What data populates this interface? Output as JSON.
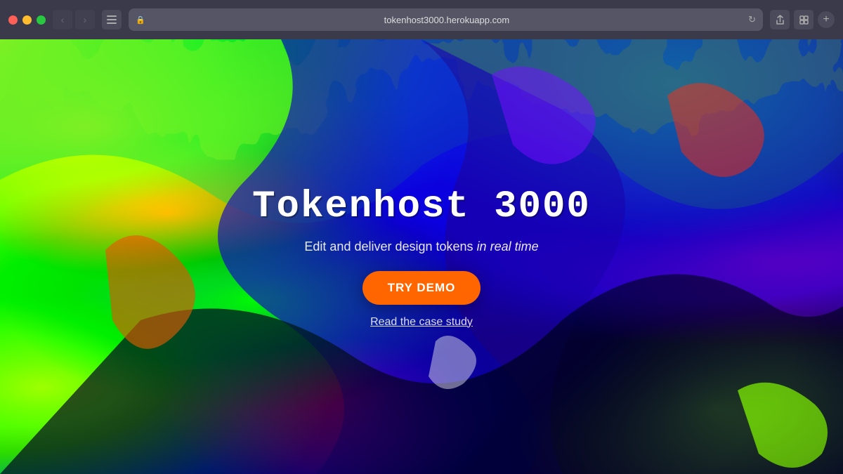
{
  "browser": {
    "url": "tokenhost3000.herokuapp.com",
    "traffic_lights": [
      "close",
      "minimize",
      "maximize"
    ],
    "back_button": "‹",
    "forward_button": "›",
    "sidebar_icon": "⊟",
    "lock_icon": "🔒",
    "refresh_icon": "↻",
    "share_icon": "↑",
    "tab_icon": "⊡",
    "add_tab": "+"
  },
  "hero": {
    "title": "Tokenhost 3000",
    "subtitle_plain": "Edit and deliver design tokens ",
    "subtitle_italic": "in real time",
    "try_demo_label": "Try Demo",
    "case_study_label": "Read the case study",
    "bg_accent_color": "#ff6600",
    "btn_color": "#ff6600"
  }
}
